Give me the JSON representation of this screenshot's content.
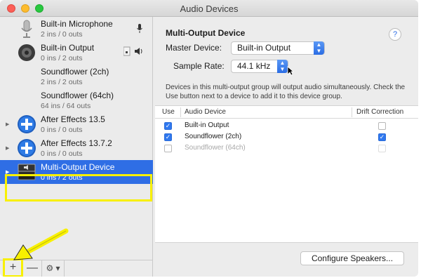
{
  "window": {
    "title": "Audio Devices"
  },
  "devices": [
    {
      "name": "Built-in Microphone",
      "io": "2 ins / 0 outs",
      "icon": "microphone-icon"
    },
    {
      "name": "Built-in Output",
      "io": "0 ins / 2 outs",
      "icon": "speaker-icon"
    },
    {
      "name": "Soundflower (2ch)",
      "io": "2 ins / 2 outs",
      "icon": ""
    },
    {
      "name": "Soundflower (64ch)",
      "io": "64 ins / 64 outs",
      "icon": ""
    },
    {
      "name": "After Effects 13.5",
      "io": "0 ins / 0 outs",
      "icon": "plus-circle-icon"
    },
    {
      "name": "After Effects 13.7.2",
      "io": "0 ins / 0 outs",
      "icon": "plus-circle-icon"
    },
    {
      "name": "Multi-Output Device",
      "io": "0 ins / 2 outs",
      "icon": "multi-output-icon",
      "selected": true
    }
  ],
  "bottombar": {
    "add_label": "+",
    "remove_label": "—",
    "gear_label": "⚙ ▾"
  },
  "detail": {
    "title": "Multi-Output Device",
    "help": "?",
    "master_label": "Master Device:",
    "master_value": "Built-in Output",
    "rate_label": "Sample Rate:",
    "rate_value": "44.1 kHz",
    "description": "Devices in this multi-output group will output audio simultaneously. Check the Use button next to a device to add it to this device group."
  },
  "table": {
    "headers": [
      "Use",
      "Audio Device",
      "Drift Correction"
    ],
    "rows": [
      {
        "device": "Built-in Output",
        "use": true,
        "drift": false,
        "enabled": true
      },
      {
        "device": "Soundflower (2ch)",
        "use": true,
        "drift": true,
        "enabled": true
      },
      {
        "device": "Soundflower (64ch)",
        "use": false,
        "drift": false,
        "enabled": false
      }
    ]
  },
  "configure_label": "Configure Speakers...",
  "colors": {
    "selection": "#2f6ee5",
    "highlight": "#f8f000",
    "accent": "#2f78ef"
  }
}
